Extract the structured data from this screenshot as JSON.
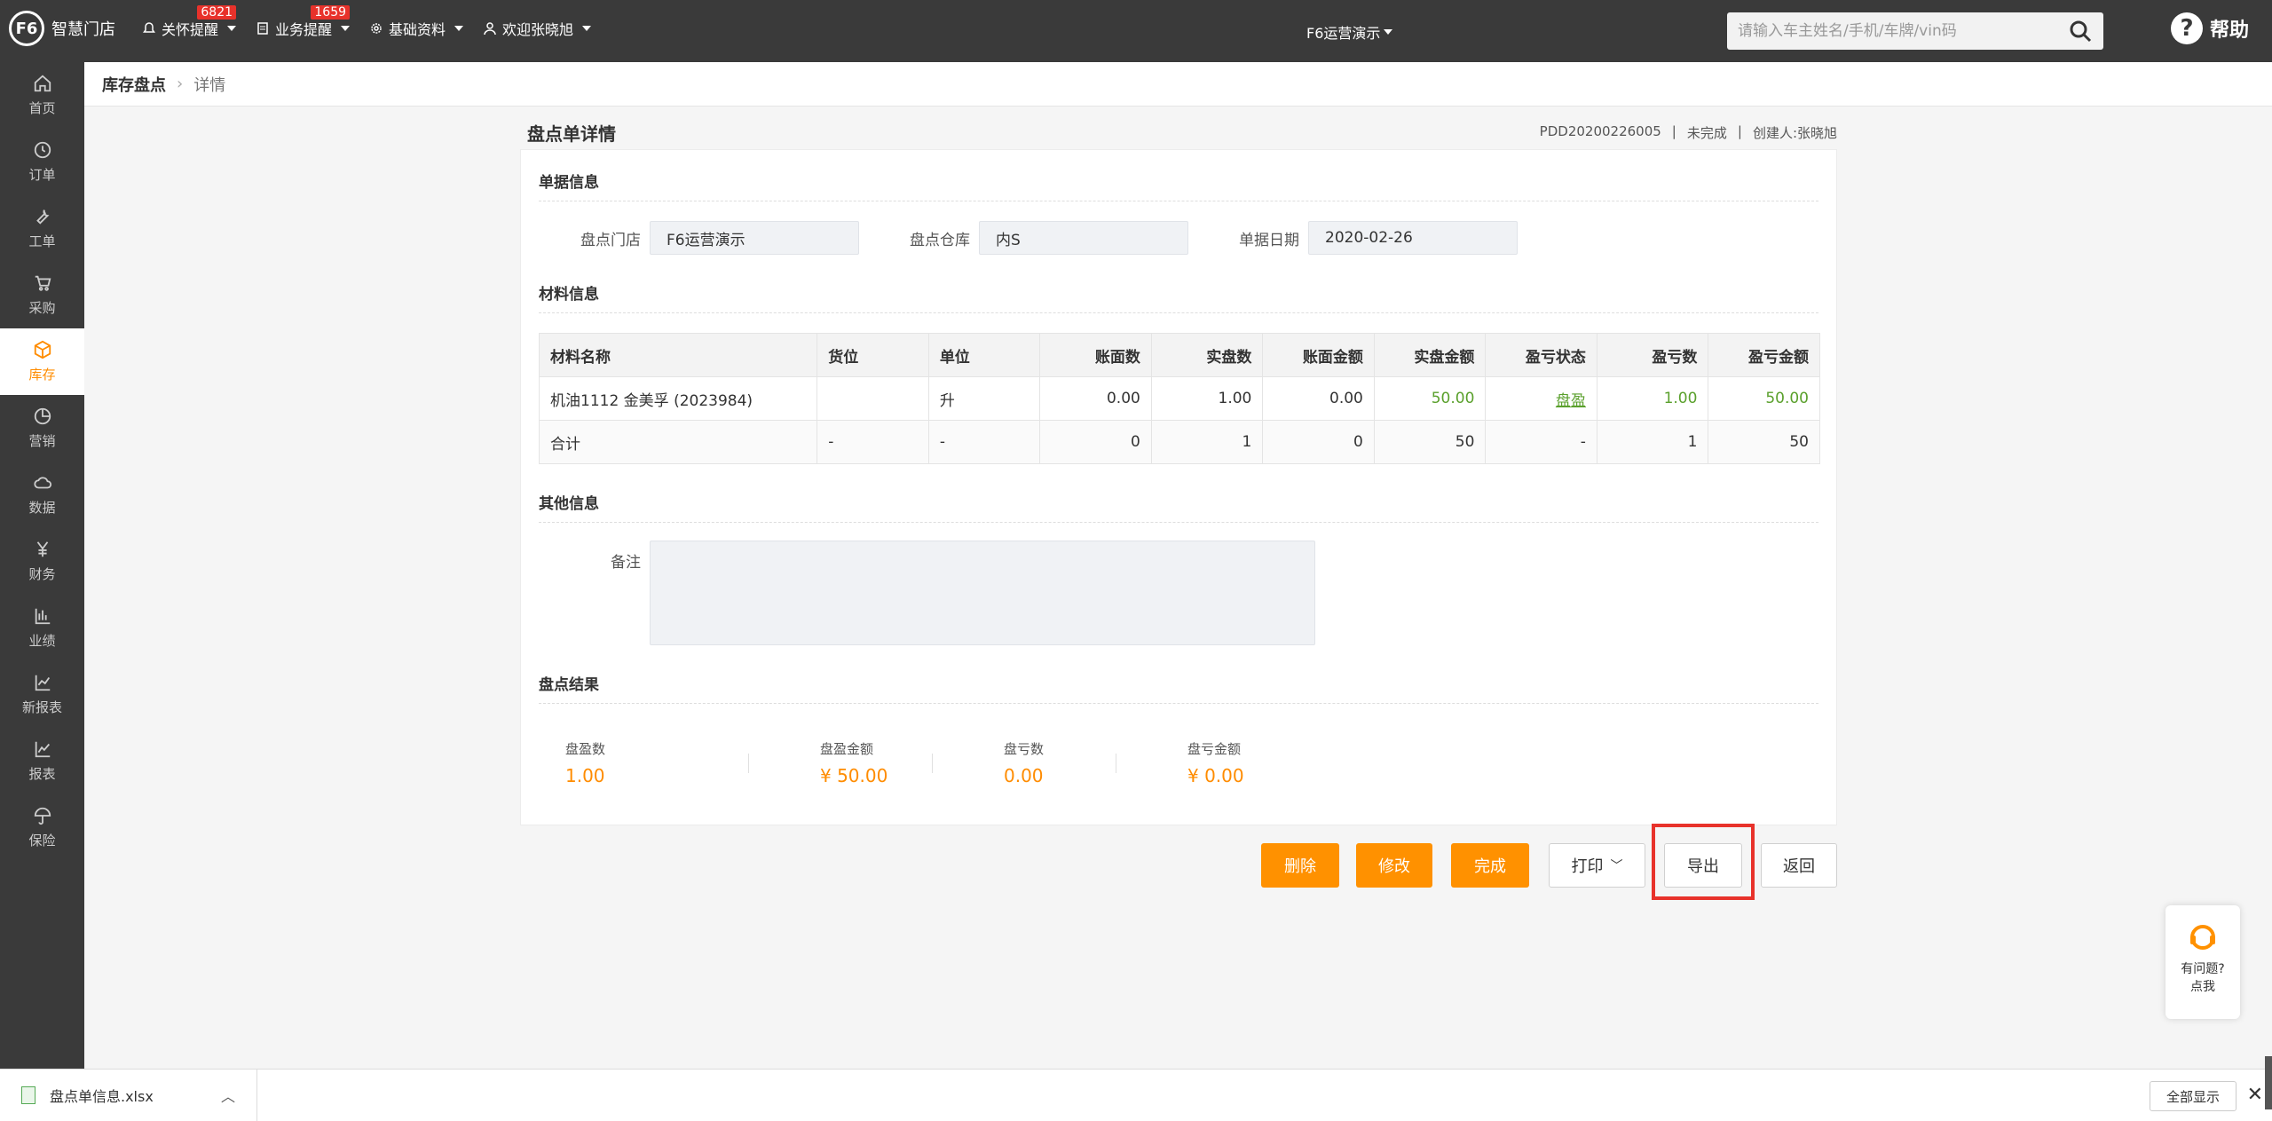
{
  "app": {
    "name": "智慧门店",
    "logo_mark": "F6"
  },
  "topnav": [
    {
      "label": "关怀提醒",
      "badge": "6821",
      "icon": "bell-icon"
    },
    {
      "label": "业务提醒",
      "badge": "1659",
      "icon": "document-icon"
    },
    {
      "label": "基础资料",
      "badge": "",
      "icon": "gear-icon"
    },
    {
      "label": "欢迎张晓旭",
      "badge": "",
      "icon": "user-icon"
    }
  ],
  "store_select": "F6运营演示",
  "search": {
    "placeholder": "请输入车主姓名/手机/车牌/vin码"
  },
  "help": {
    "label": "帮助"
  },
  "sidebar": [
    {
      "label": "首页",
      "icon": "home-icon"
    },
    {
      "label": "订单",
      "icon": "order-icon"
    },
    {
      "label": "工单",
      "icon": "wrench-icon"
    },
    {
      "label": "采购",
      "icon": "cart-icon"
    },
    {
      "label": "库存",
      "icon": "box-icon",
      "active": true
    },
    {
      "label": "营销",
      "icon": "pie-icon"
    },
    {
      "label": "数据",
      "icon": "cloud-icon"
    },
    {
      "label": "财务",
      "icon": "yuan-icon"
    },
    {
      "label": "业绩",
      "icon": "bars-icon"
    },
    {
      "label": "新报表",
      "icon": "line-chart-icon"
    },
    {
      "label": "报表",
      "icon": "report-icon"
    },
    {
      "label": "保险",
      "icon": "umbrella-icon"
    }
  ],
  "breadcrumb": {
    "root": "库存盘点",
    "current": "详情"
  },
  "header": {
    "title": "盘点单详情",
    "order_no": "PDD20200226005",
    "status": "未完成",
    "creator": "创建人:张晓旭",
    "sep": "|"
  },
  "doc_info": {
    "title": "单据信息",
    "store_label": "盘点门店",
    "store_value": "F6运营演示",
    "warehouse_label": "盘点仓库",
    "warehouse_value": "内S",
    "date_label": "单据日期",
    "date_value": "2020-02-26"
  },
  "material": {
    "title": "材料信息",
    "headers": [
      "材料名称",
      "货位",
      "单位",
      "账面数",
      "实盘数",
      "账面金额",
      "实盘金额",
      "盈亏状态",
      "盈亏数",
      "盈亏金额"
    ],
    "rows": [
      [
        "机油1112 金美孚 (2023984)",
        "",
        "升",
        "0.00",
        "1.00",
        "0.00",
        "50.00",
        "盘盈",
        "1.00",
        "50.00"
      ]
    ],
    "total": [
      "合计",
      "-",
      "-",
      "0",
      "1",
      "0",
      "50",
      "-",
      "1",
      "50"
    ]
  },
  "other": {
    "title": "其他信息",
    "remark_label": "备注"
  },
  "result": {
    "title": "盘点结果",
    "items": [
      {
        "label": "盘盈数",
        "value": "1.00"
      },
      {
        "label": "盘盈金额",
        "value": "¥ 50.00"
      },
      {
        "label": "盘亏数",
        "value": "0.00"
      },
      {
        "label": "盘亏金额",
        "value": "¥ 0.00"
      }
    ]
  },
  "actions": {
    "delete": "删除",
    "edit": "修改",
    "finish": "完成",
    "print": "打印",
    "export": "导出",
    "back": "返回"
  },
  "float_help": {
    "line1": "有问题?",
    "line2": "点我"
  },
  "download": {
    "file": "盘点单信息.xlsx",
    "show_all": "全部显示",
    "close": "✕"
  },
  "colors": {
    "accent": "#ff9100",
    "topbar": "#3a3a3a",
    "highlight": "#e8322b",
    "positive": "#5aa02c"
  }
}
